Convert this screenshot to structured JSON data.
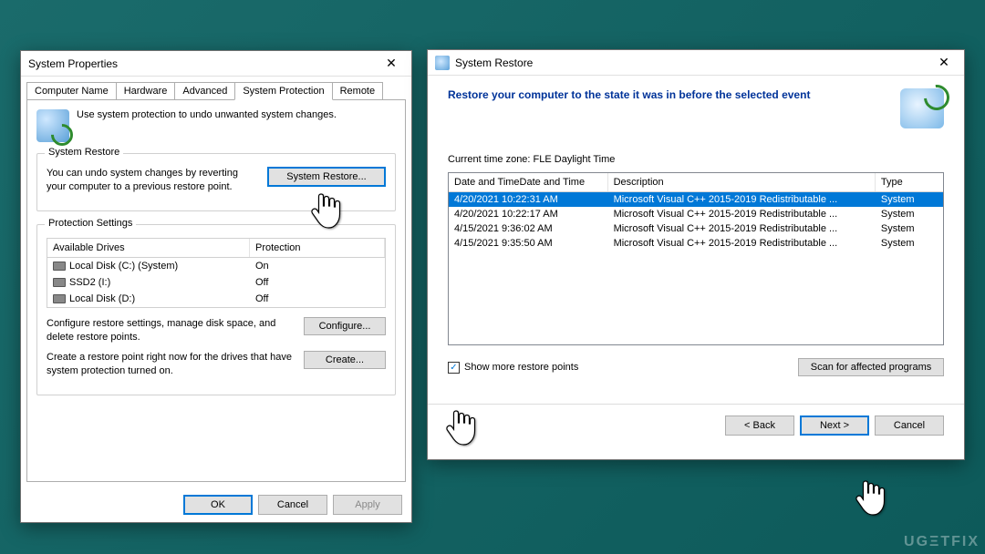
{
  "watermark": "UGΞTFIX",
  "win1": {
    "title": "System Properties",
    "tabs": [
      "Computer Name",
      "Hardware",
      "Advanced",
      "System Protection",
      "Remote"
    ],
    "activeTab": 3,
    "intro": "Use system protection to undo unwanted system changes.",
    "restore": {
      "group": "System Restore",
      "text": "You can undo system changes by reverting your computer to a previous restore point.",
      "btn": "System Restore..."
    },
    "protection": {
      "group": "Protection Settings",
      "headers": [
        "Available Drives",
        "Protection"
      ],
      "rows": [
        {
          "name": "Local Disk (C:) (System)",
          "prot": "On"
        },
        {
          "name": "SSD2 (I:)",
          "prot": "Off"
        },
        {
          "name": "Local Disk (D:)",
          "prot": "Off"
        }
      ],
      "configure_text": "Configure restore settings, manage disk space, and delete restore points.",
      "configure_btn": "Configure...",
      "create_text": "Create a restore point right now for the drives that have system protection turned on.",
      "create_btn": "Create..."
    },
    "footer": {
      "ok": "OK",
      "cancel": "Cancel",
      "apply": "Apply"
    }
  },
  "win2": {
    "title": "System Restore",
    "heading": "Restore your computer to the state it was in before the selected event",
    "timezone": "Current time zone: FLE Daylight Time",
    "headers": [
      "Date and Time",
      "Description",
      "Type"
    ],
    "rows": [
      {
        "dt": "4/20/2021 10:22:31 AM",
        "desc": "Microsoft Visual C++ 2015-2019 Redistributable ...",
        "type": "System",
        "sel": true
      },
      {
        "dt": "4/20/2021 10:22:17 AM",
        "desc": "Microsoft Visual C++ 2015-2019 Redistributable ...",
        "type": "System",
        "sel": false
      },
      {
        "dt": "4/15/2021 9:36:02 AM",
        "desc": "Microsoft Visual C++ 2015-2019 Redistributable ...",
        "type": "System",
        "sel": false
      },
      {
        "dt": "4/15/2021 9:35:50 AM",
        "desc": "Microsoft Visual C++ 2015-2019 Redistributable ...",
        "type": "System",
        "sel": false
      }
    ],
    "show_more": "Show more restore points",
    "scan_btn": "Scan for affected programs",
    "footer": {
      "back": "< Back",
      "next": "Next >",
      "cancel": "Cancel"
    }
  }
}
